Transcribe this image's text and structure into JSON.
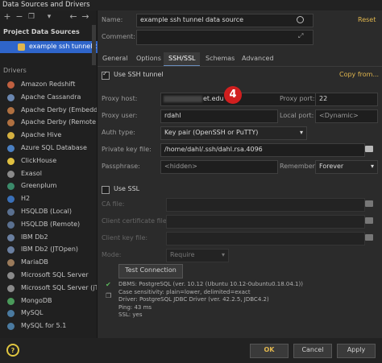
{
  "window": {
    "title": "Data Sources and Drivers"
  },
  "toolbar": {
    "add": "+",
    "remove": "−",
    "duplicate": "❐",
    "back": "←",
    "forward": "→",
    "more": "▾"
  },
  "sidebar": {
    "project_header": "Project Data Sources",
    "project_item": "example ssh tunnel d",
    "drivers_header": "Drivers",
    "drivers": [
      "Amazon Redshift",
      "Apache Cassandra",
      "Apache Derby (Embedd",
      "Apache Derby (Remote",
      "Apache Hive",
      "Azure SQL Database",
      "ClickHouse",
      "Exasol",
      "Greenplum",
      "H2",
      "HSQLDB (Local)",
      "HSQLDB (Remote)",
      "IBM Db2",
      "IBM Db2 (JTOpen)",
      "MariaDB",
      "Microsoft SQL Server",
      "Microsoft SQL Server (jT",
      "MongoDB",
      "MySQL",
      "MySQL for 5.1"
    ]
  },
  "form": {
    "name_label": "Name:",
    "name_value": "example ssh tunnel data source",
    "reset": "Reset",
    "comment_label": "Comment:",
    "tabs": [
      "General",
      "Options",
      "SSH/SSL",
      "Schemas",
      "Advanced"
    ],
    "use_ssh_label": "Use SSH tunnel",
    "copy_from": "Copy from...",
    "proxy_host_label": "Proxy host:",
    "proxy_host_value": "et.edu",
    "proxy_port_label": "Proxy port:",
    "proxy_port_value": "22",
    "proxy_user_label": "Proxy user:",
    "proxy_user_value": "rdahl",
    "local_port_label": "Local port:",
    "local_port_value": "<Dynamic>",
    "auth_label": "Auth type:",
    "auth_value": "Key pair (OpenSSH or PuTTY)",
    "keyfile_label": "Private key file:",
    "keyfile_value": "/home/dahl/.ssh/dahl.rsa.4096",
    "passphrase_label": "Passphrase:",
    "passphrase_value": "<hidden>",
    "remember_label": "Remember:",
    "remember_value": "Forever",
    "use_ssl_label": "Use SSL",
    "ca_label": "CA file:",
    "client_cert_label": "Client certificate file:",
    "client_key_label": "Client key file:",
    "mode_label": "Mode:",
    "mode_value": "Require",
    "test_button": "Test Connection",
    "status_lines": [
      "DBMS: PostgreSQL (ver. 10.12 (Ubuntu 10.12-0ubuntu0.18.04.1))",
      "Case sensitivity: plain=lower, delimited=exact",
      "Driver: PostgreSQL JDBC Driver (ver. 42.2.5, JDBC4.2)",
      "Ping: 43 ms",
      "SSL: yes"
    ],
    "annotation_number": "4"
  },
  "footer": {
    "help": "?",
    "ok": "OK",
    "cancel": "Cancel",
    "apply": "Apply"
  },
  "colors": {
    "selection": "#2f65ca",
    "badge": "#d11f1f",
    "ok_text": "#e0b64e",
    "reset": "#e0b64e"
  }
}
